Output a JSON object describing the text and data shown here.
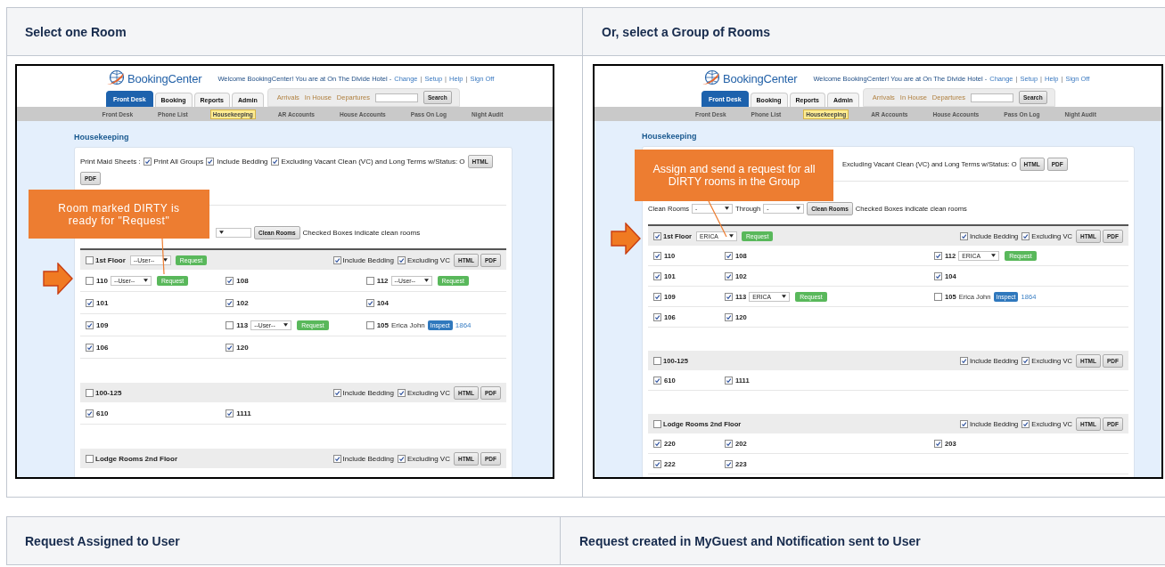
{
  "top_table": {
    "headers": [
      "Select one Room",
      "Or, select a Group of Rooms"
    ],
    "screens": [
      {
        "logo": "BookingCenter",
        "welcome": "Welcome BookingCenter! You are at On The Divide Hotel -",
        "account_links": [
          {
            "kind": "link",
            "text": "Change"
          },
          {
            "kind": "separator",
            "text": "|"
          },
          {
            "kind": "link",
            "text": "Setup"
          },
          {
            "kind": "separator",
            "text": "|"
          },
          {
            "kind": "link",
            "text": "Help"
          },
          {
            "kind": "separator",
            "text": "|"
          },
          {
            "kind": "link",
            "text": "Sign Off"
          }
        ],
        "tabs": [
          {
            "label": "Front Desk",
            "selected": true
          },
          {
            "label": "Booking",
            "selected": false
          },
          {
            "label": "Reports",
            "selected": false
          },
          {
            "label": "Admin",
            "selected": false
          }
        ],
        "quick_links": [
          "Arrivals",
          "In House",
          "Departures"
        ],
        "search_button": "Search",
        "subnav": [
          {
            "label": "Front Desk",
            "selected": false
          },
          {
            "label": "Phone List",
            "selected": false
          },
          {
            "label": "Housekeeping",
            "selected": true
          },
          {
            "label": "AR Accounts",
            "selected": false
          },
          {
            "label": "House Accounts",
            "selected": false
          },
          {
            "label": "Pass On Log",
            "selected": false
          },
          {
            "label": "Night Audit",
            "selected": false
          }
        ],
        "page_title": "Housekeeping",
        "print_line": [
          {
            "kind": "text",
            "text": "Print Maid Sheets :"
          },
          {
            "kind": "checkbox",
            "checked": true,
            "label": "Print All Groups"
          },
          {
            "kind": "checkbox",
            "checked": true,
            "label": "Include Bedding"
          },
          {
            "kind": "checkbox",
            "checked": true,
            "label": "Excluding Vacant Clean (VC) and Long Terms w/Status: O"
          }
        ],
        "print_buttons": [
          "HTML",
          "PDF"
        ],
        "clean_row": [
          {
            "kind": "select"
          },
          {
            "kind": "button",
            "text": "Clean Rooms"
          },
          {
            "kind": "label",
            "text": "Checked Boxes indicate clean rooms"
          }
        ],
        "groups": [
          {
            "name": "1st Floor",
            "checked": false,
            "assign": {
              "user": "--User--",
              "button": "Request"
            },
            "options": [
              {
                "label": "Include Bedding",
                "checked": true
              },
              {
                "label": "Excluding VC",
                "checked": true
              }
            ],
            "buttons": [
              "HTML",
              "PDF"
            ],
            "rows": [
              [
                {
                  "number": "110",
                  "checked": false,
                  "assign": {
                    "user": "--User--",
                    "button": "Request"
                  }
                },
                {
                  "number": "108",
                  "checked": true
                },
                {
                  "number": "112",
                  "checked": false,
                  "assign": {
                    "user": "--User--",
                    "button": "Request"
                  }
                }
              ],
              [
                {
                  "number": "101",
                  "checked": true
                },
                {
                  "number": "102",
                  "checked": true
                },
                {
                  "number": "104",
                  "checked": true
                }
              ],
              [
                {
                  "number": "109",
                  "checked": true
                },
                {
                  "number": "113",
                  "checked": false,
                  "assign": {
                    "user": "--User--",
                    "button": "Request"
                  }
                },
                {
                  "number": "105",
                  "checked": false,
                  "guest": "Erica John",
                  "status_button": "Inspect",
                  "link": "1864"
                }
              ],
              [
                {
                  "number": "106",
                  "checked": true
                },
                {
                  "number": "120",
                  "checked": true
                }
              ]
            ]
          },
          {
            "name": "100-125",
            "checked": false,
            "options": [
              {
                "label": "Include Bedding",
                "checked": true
              },
              {
                "label": "Excluding VC",
                "checked": true
              }
            ],
            "buttons": [
              "HTML",
              "PDF"
            ],
            "rows": [
              [
                {
                  "number": "610",
                  "checked": true
                },
                {
                  "number": "1111",
                  "checked": true
                }
              ]
            ]
          },
          {
            "name": "Lodge Rooms 2nd Floor",
            "checked": false,
            "options": [
              {
                "label": "Include Bedding",
                "checked": true
              },
              {
                "label": "Excluding VC",
                "checked": true
              }
            ],
            "buttons": [
              "HTML",
              "PDF"
            ]
          }
        ],
        "callout": {
          "text": "Room marked DIRTY is ready for \"Request\""
        }
      },
      {
        "logo": "BookingCenter",
        "welcome": "Welcome BookingCenter! You are at On The Divide Hotel -",
        "account_links": [
          {
            "kind": "link",
            "text": "Change"
          },
          {
            "kind": "separator",
            "text": "|"
          },
          {
            "kind": "link",
            "text": "Setup"
          },
          {
            "kind": "separator",
            "text": "|"
          },
          {
            "kind": "link",
            "text": "Help"
          },
          {
            "kind": "separator",
            "text": "|"
          },
          {
            "kind": "link",
            "text": "Sign Off"
          }
        ],
        "tabs": [
          {
            "label": "Front Desk",
            "selected": true
          },
          {
            "label": "Booking",
            "selected": false
          },
          {
            "label": "Reports",
            "selected": false
          },
          {
            "label": "Admin",
            "selected": false
          }
        ],
        "quick_links": [
          "Arrivals",
          "In House",
          "Departures"
        ],
        "search_button": "Search",
        "subnav": [
          {
            "label": "Front Desk",
            "selected": false
          },
          {
            "label": "Phone List",
            "selected": false
          },
          {
            "label": "Housekeeping",
            "selected": true
          },
          {
            "label": "AR Accounts",
            "selected": false
          },
          {
            "label": "House Accounts",
            "selected": false
          },
          {
            "label": "Pass On Log",
            "selected": false
          },
          {
            "label": "Night Audit",
            "selected": false
          }
        ],
        "page_title": "Housekeeping",
        "print_line": [
          {
            "kind": "text",
            "text": "Excluding Vacant Clean (VC) and Long Terms w/Status: O"
          }
        ],
        "print_buttons": [
          "HTML",
          "PDF"
        ],
        "clean_row": [
          {
            "kind": "label",
            "text": "Clean Rooms"
          },
          {
            "kind": "select",
            "value": "-"
          },
          {
            "kind": "label",
            "text": "Through"
          },
          {
            "kind": "select",
            "value": "-"
          },
          {
            "kind": "button",
            "text": "Clean Rooms"
          },
          {
            "kind": "label",
            "text": "Checked Boxes indicate clean rooms"
          }
        ],
        "groups": [
          {
            "name": "1st Floor",
            "checked": true,
            "assign": {
              "user": "ERICA",
              "button": "Request"
            },
            "options": [
              {
                "label": "Include Bedding",
                "checked": true
              },
              {
                "label": "Excluding VC",
                "checked": true
              }
            ],
            "buttons": [
              "HTML",
              "PDF"
            ],
            "rows": [
              [
                {
                  "number": "110",
                  "checked": true
                },
                {
                  "number": "108",
                  "checked": true
                },
                {
                  "number": "112",
                  "checked": true,
                  "assign": {
                    "user": "ERICA",
                    "button": "Request"
                  }
                }
              ],
              [
                {
                  "number": "101",
                  "checked": true
                },
                {
                  "number": "102",
                  "checked": true
                },
                {
                  "number": "104",
                  "checked": true
                }
              ],
              [
                {
                  "number": "109",
                  "checked": true
                },
                {
                  "number": "113",
                  "checked": true,
                  "assign": {
                    "user": "ERICA",
                    "button": "Request"
                  }
                },
                {
                  "number": "105",
                  "checked": false,
                  "guest": "Erica John",
                  "status_button": "Inspect",
                  "link": "1864"
                }
              ],
              [
                {
                  "number": "106",
                  "checked": true
                },
                {
                  "number": "120",
                  "checked": true
                }
              ]
            ]
          },
          {
            "name": "100-125",
            "checked": false,
            "options": [
              {
                "label": "Include Bedding",
                "checked": true
              },
              {
                "label": "Excluding VC",
                "checked": true
              }
            ],
            "buttons": [
              "HTML",
              "PDF"
            ],
            "rows": [
              [
                {
                  "number": "610",
                  "checked": true
                },
                {
                  "number": "1111",
                  "checked": true
                }
              ]
            ]
          },
          {
            "name": "Lodge Rooms 2nd Floor",
            "checked": false,
            "options": [
              {
                "label": "Include Bedding",
                "checked": true
              },
              {
                "label": "Excluding VC",
                "checked": true
              }
            ],
            "buttons": [
              "HTML",
              "PDF"
            ],
            "rows": [
              [
                {
                  "number": "220",
                  "checked": true
                },
                {
                  "number": "202",
                  "checked": true
                },
                {
                  "number": "203",
                  "checked": true
                }
              ],
              [
                {
                  "number": "222",
                  "checked": true
                },
                {
                  "number": "223",
                  "checked": true
                }
              ]
            ]
          }
        ],
        "callout": {
          "text": "Assign and send a request for all DIRTY rooms in the Group"
        }
      }
    ]
  },
  "bottom_table": {
    "headers": [
      "Request Assigned to User",
      "Request created in MyGuest and Notification sent to User"
    ]
  }
}
